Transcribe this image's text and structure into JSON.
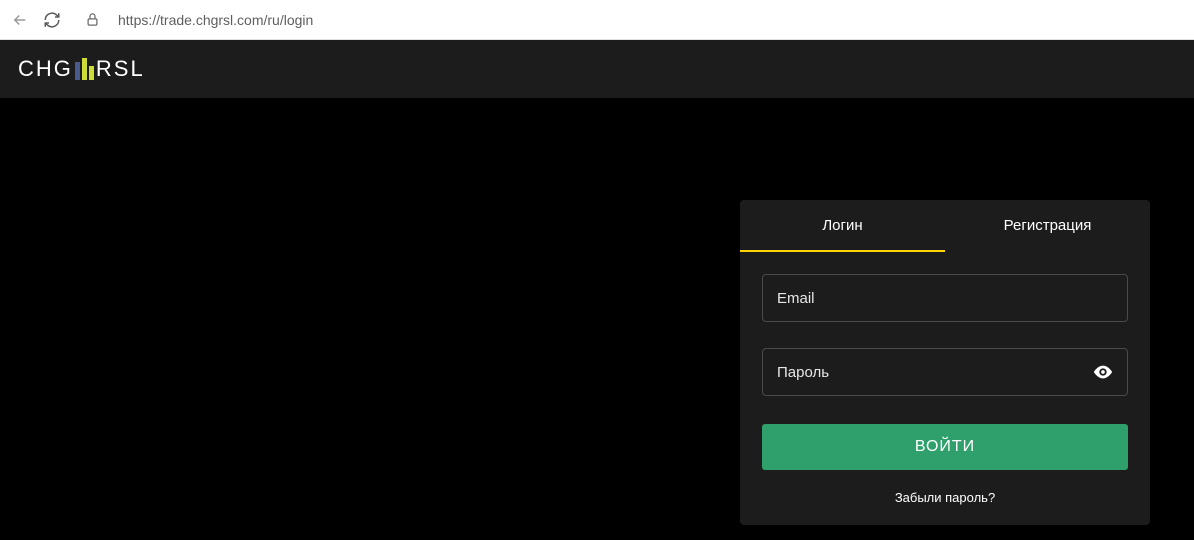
{
  "browser": {
    "url": "https://trade.chgrsl.com/ru/login"
  },
  "header": {
    "logo_part1": "CHG",
    "logo_part2": "RSL"
  },
  "login": {
    "tabs": {
      "login": "Логин",
      "register": "Регистрация"
    },
    "email_placeholder": "Email",
    "password_placeholder": "Пароль",
    "submit_label": "ВОЙТИ",
    "forgot_label": "Забыли пароль?"
  }
}
